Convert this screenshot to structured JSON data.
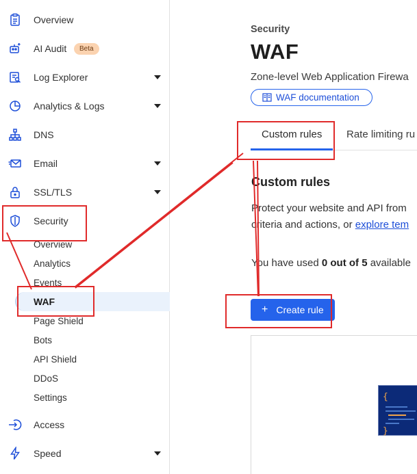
{
  "sidebar": {
    "items": [
      {
        "label": "Overview",
        "icon": "clipboard-icon"
      },
      {
        "label": "AI Audit",
        "icon": "robot-icon",
        "badge": "Beta"
      },
      {
        "label": "Log Explorer",
        "icon": "document-search-icon"
      },
      {
        "label": "Analytics & Logs",
        "icon": "pie-chart-icon"
      },
      {
        "label": "DNS",
        "icon": "network-icon"
      },
      {
        "label": "Email",
        "icon": "envelope-icon"
      },
      {
        "label": "SSL/TLS",
        "icon": "lock-icon"
      },
      {
        "label": "Security",
        "icon": "shield-icon"
      },
      {
        "label": "Access",
        "icon": "access-arrow-icon"
      },
      {
        "label": "Speed",
        "icon": "lightning-icon"
      }
    ],
    "security_sub": [
      "Overview",
      "Analytics",
      "Events",
      "WAF",
      "Page Shield",
      "Bots",
      "API Shield",
      "DDoS",
      "Settings"
    ]
  },
  "main": {
    "breadcrumb": "Security",
    "title": "WAF",
    "subtitle": "Zone-level Web Application Firewa",
    "doc_button": "WAF documentation",
    "tabs": [
      "Custom rules",
      "Rate limiting ru"
    ],
    "section_title": "Custom rules",
    "desc_line1": "Protect your website and API from",
    "desc_line2_prefix": "criteria and actions, or ",
    "desc_line2_link": "explore tem",
    "usage_prefix": "You have used ",
    "usage_bold": "0 out of 5",
    "usage_suffix": " available",
    "create_button": "Create rule",
    "create_button_plus": "+"
  },
  "colors": {
    "accent": "#2563eb",
    "annotation": "#e02a2a",
    "active_bg": "#eaf2fc",
    "beta_bg": "#fbd3b0"
  }
}
